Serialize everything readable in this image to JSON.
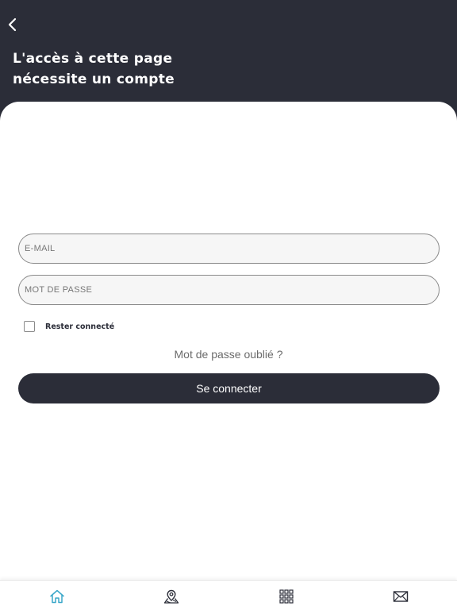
{
  "header": {
    "title_line1": "L'accès à cette page",
    "title_line2": "nécessite un compte"
  },
  "form": {
    "email_placeholder": "E-MAIL",
    "password_placeholder": "MOT DE PASSE",
    "remember_label": "Rester connecté",
    "remember_checked": false,
    "forgot_label": "Mot de passe oublié ?",
    "submit_label": "Se connecter"
  },
  "tabbar": {
    "items": [
      {
        "icon": "home-icon",
        "active": true
      },
      {
        "icon": "map-pin-icon",
        "active": false
      },
      {
        "icon": "grid-icon",
        "active": false
      },
      {
        "icon": "mail-icon",
        "active": false
      }
    ]
  },
  "colors": {
    "primary": "#2b2d38",
    "accent": "#3aa7c9",
    "background": "#ffffff",
    "field_bg": "#f6f6f6"
  }
}
